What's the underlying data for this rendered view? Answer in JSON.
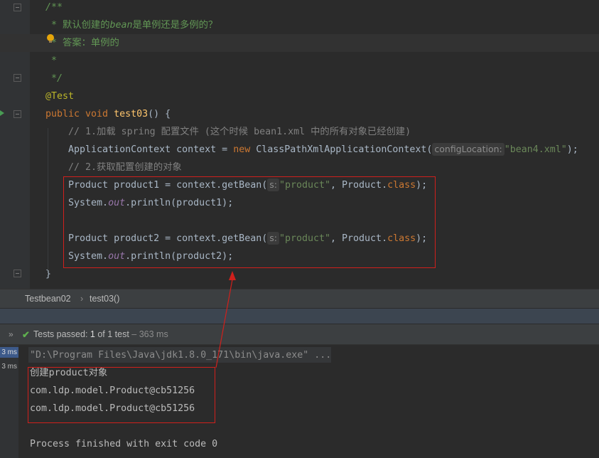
{
  "editor": {
    "lines": [
      {
        "id": "l1",
        "segments": [
          {
            "t": "/**",
            "c": "c-doc"
          }
        ]
      },
      {
        "id": "l2",
        "segments": [
          {
            "t": " * 默认创建的",
            "c": "c-doc-n"
          },
          {
            "t": "bean",
            "c": "c-doc"
          },
          {
            "t": "是单例还是多例的？",
            "c": "c-doc-n"
          }
        ]
      },
      {
        "id": "l3",
        "segments": [
          {
            "t": " * 答案：单例的",
            "c": "c-doc-n"
          }
        ]
      },
      {
        "id": "l4",
        "segments": [
          {
            "t": " *",
            "c": "c-doc"
          }
        ]
      },
      {
        "id": "l5",
        "segments": [
          {
            "t": " */",
            "c": "c-doc"
          }
        ]
      },
      {
        "id": "l6",
        "segments": [
          {
            "t": "@Test",
            "c": "c-ann"
          }
        ]
      },
      {
        "id": "l7",
        "segments": [
          {
            "t": "public void ",
            "c": "c-kw"
          },
          {
            "t": "test03",
            "c": "c-fn"
          },
          {
            "t": "() {",
            "c": ""
          }
        ]
      },
      {
        "id": "l8",
        "segments": [
          {
            "t": "    // 1.加载 spring 配置文件 (这个时候 bean1.xml 中的所有对象已经创建)",
            "c": "c-cmt"
          }
        ]
      },
      {
        "id": "l9",
        "segments": [
          {
            "t": "    ApplicationContext context = ",
            "c": ""
          },
          {
            "t": "new ",
            "c": "c-kw"
          },
          {
            "t": "ClassPathXmlApplicationContext(",
            "c": ""
          },
          {
            "t": "configLocation:",
            "c": "hint"
          },
          {
            "t": "\"bean4.xml\"",
            "c": "c-str"
          },
          {
            "t": ");",
            "c": ""
          }
        ]
      },
      {
        "id": "l10",
        "segments": [
          {
            "t": "    // 2.获取配置创建的对象",
            "c": "c-cmt"
          }
        ]
      },
      {
        "id": "l11",
        "segments": [
          {
            "t": "    Product product1 = context.getBean(",
            "c": ""
          },
          {
            "t": "s:",
            "c": "hint"
          },
          {
            "t": "\"product\"",
            "c": "c-str"
          },
          {
            "t": ", Product.",
            "c": ""
          },
          {
            "t": "class",
            "c": "c-kw"
          },
          {
            "t": ");",
            "c": ""
          }
        ]
      },
      {
        "id": "l12",
        "segments": [
          {
            "t": "    System.",
            "c": ""
          },
          {
            "t": "out",
            "c": "c-static"
          },
          {
            "t": ".println(product1);",
            "c": ""
          }
        ]
      },
      {
        "id": "l13",
        "segments": []
      },
      {
        "id": "l14",
        "segments": [
          {
            "t": "    Product product2 = context.getBean(",
            "c": ""
          },
          {
            "t": "s:",
            "c": "hint"
          },
          {
            "t": "\"product\"",
            "c": "c-str"
          },
          {
            "t": ", Product.",
            "c": ""
          },
          {
            "t": "class",
            "c": "c-kw"
          },
          {
            "t": ");",
            "c": ""
          }
        ]
      },
      {
        "id": "l15",
        "segments": [
          {
            "t": "    System.",
            "c": ""
          },
          {
            "t": "out",
            "c": "c-static"
          },
          {
            "t": ".println(product2);",
            "c": ""
          }
        ]
      },
      {
        "id": "l16",
        "segments": [
          {
            "t": "}",
            "c": ""
          }
        ]
      }
    ]
  },
  "breadcrumb": {
    "class_name": "Testbean02",
    "separator": "›",
    "method_name": "test03()"
  },
  "test_toolbar": {
    "expand_icon": "»",
    "check_icon": "✔",
    "status_prefix": "Tests passed: ",
    "passed": "1",
    "of_text": " of 1 test",
    "time": " – 363 ms"
  },
  "console": {
    "gutter_times": [
      "3 ms",
      "3 ms"
    ],
    "command": "\"D:\\Program Files\\Java\\jdk1.8.0_171\\bin\\java.exe\" ...",
    "output": [
      "创建product对象",
      "com.ldp.model.Product@cb51256",
      "com.ldp.model.Product@cb51256"
    ],
    "exit": "Process finished with exit code 0"
  },
  "colors": {
    "annotation_box": "#d0201c",
    "pass_check": "#5fb04f",
    "selected_time": "#3d5a8a"
  }
}
